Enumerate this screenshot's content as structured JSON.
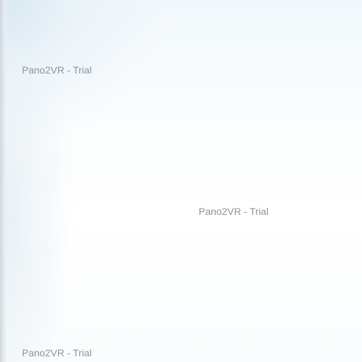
{
  "watermarks": [
    {
      "text": "Pano2VR - Trial"
    },
    {
      "text": "Pano2VR - Trial"
    },
    {
      "text": "Pano2VR - Trial"
    }
  ]
}
